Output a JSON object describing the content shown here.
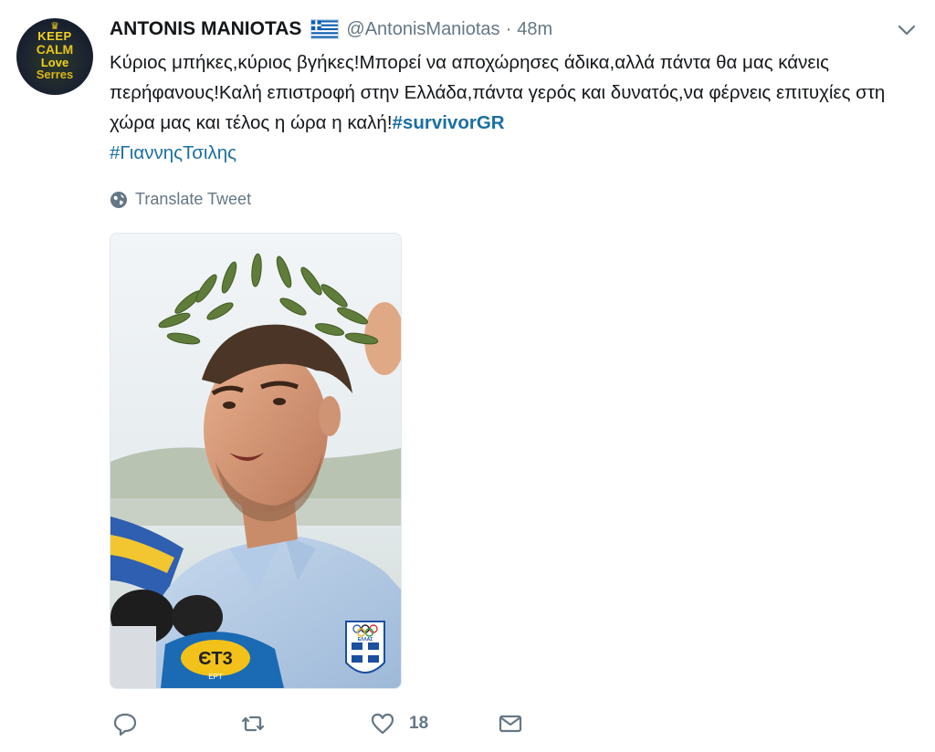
{
  "tweet": {
    "avatar": {
      "line1": "KEEP",
      "line2": "CALM",
      "line3": "Love",
      "line4": "Serres"
    },
    "author_name": "ANTONIS MANIOTAS",
    "handle": "@AntonisManiotas",
    "separator": "·",
    "time": "48m",
    "text_main": "Κύριος μπήκες,κύριος βγήκες!Μπορεί να αποχώρησες άδικα,αλλά πάντα θα μας κάνεις περήφανους!Καλή επιστροφή στην Ελλάδα,πάντα γερός και δυνατός,να φέρνεις επιτυχίες στη χώρα μας και τέλος η ώρα η καλή!",
    "hashtag1": "#survivorGR",
    "hashtag2": "#ΓιαννηςΤσιλης",
    "translate_label": "Translate Tweet",
    "photo_icons": [
      "olympic-rings-icon",
      "greek-cross-badge-icon"
    ],
    "photo_text": {
      "mic_logo": "ЄΤ3",
      "mic_sub": "ΕΡΤ",
      "badge_label": "ΕΛΛΑΣ"
    },
    "actions": {
      "reply_icon": "reply-icon",
      "retweet_icon": "retweet-icon",
      "like_icon": "heart-icon",
      "like_count": "18",
      "dm_icon": "envelope-icon"
    },
    "colors": {
      "link": "#1b6fa1",
      "muted": "#657786",
      "text": "#14171a"
    }
  }
}
